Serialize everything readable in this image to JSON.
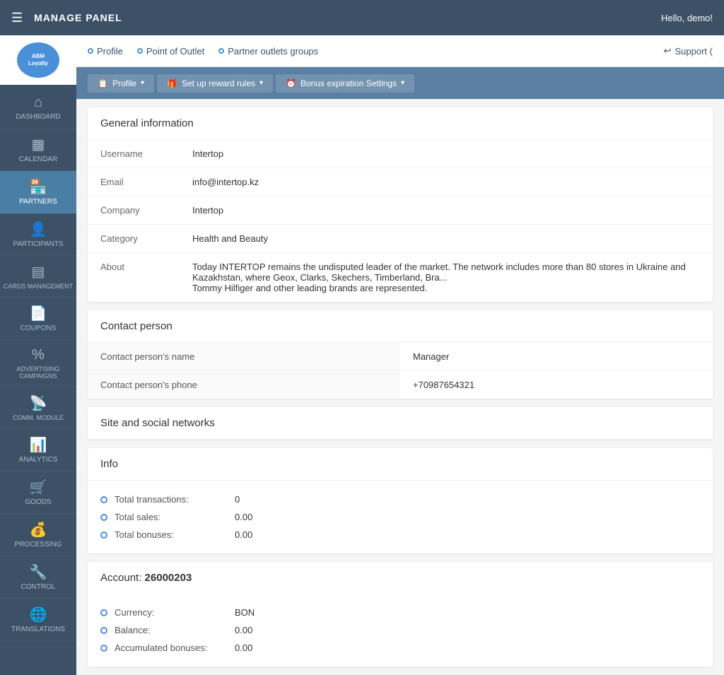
{
  "topbar": {
    "hamburger": "☰",
    "title": "MANAGE PANEL",
    "hello": "Hello, demo!"
  },
  "sidebar": {
    "logo_text": "ABM Loyalty",
    "items": [
      {
        "id": "dashboard",
        "label": "DASHBOARD",
        "icon": "⌂"
      },
      {
        "id": "calendar",
        "label": "CALENDAR",
        "icon": "📅"
      },
      {
        "id": "partners",
        "label": "PARTNERS",
        "icon": "🏪",
        "active": true
      },
      {
        "id": "participants",
        "label": "PARTICIPANTS",
        "icon": "👤"
      },
      {
        "id": "cards",
        "label": "CARDS MANAGEMENT",
        "icon": "💳"
      },
      {
        "id": "coupons",
        "label": "COUPONS",
        "icon": "📄"
      },
      {
        "id": "advertising",
        "label": "ADVERTISING CAMPAIGNS",
        "icon": "%"
      },
      {
        "id": "comm_module",
        "label": "COMM. MODULE",
        "icon": "📡"
      },
      {
        "id": "analytics",
        "label": "ANALYTICS",
        "icon": "📊"
      },
      {
        "id": "goods",
        "label": "GOODS",
        "icon": "🛒"
      },
      {
        "id": "processing",
        "label": "PROCESSING",
        "icon": "💰"
      },
      {
        "id": "control",
        "label": "CONTROL",
        "icon": "🔧"
      },
      {
        "id": "translations",
        "label": "TRANSLATIONS",
        "icon": "🌐"
      }
    ]
  },
  "breadcrumb": {
    "items": [
      {
        "label": "Profile",
        "active": false
      },
      {
        "label": "Point of Outlet",
        "active": false
      },
      {
        "label": "Partner outlets groups",
        "active": false
      }
    ],
    "support": "Support ("
  },
  "subnav": {
    "buttons": [
      {
        "id": "profile",
        "label": "Profile",
        "icon": "📋"
      },
      {
        "id": "setup_reward",
        "label": "Set up reward rules",
        "icon": "🎁"
      },
      {
        "id": "bonus_expiration",
        "label": "Bonus expiration Settings",
        "icon": "⏰"
      }
    ]
  },
  "general_info": {
    "title": "General information",
    "rows": [
      {
        "label": "Username",
        "value": "Intertop"
      },
      {
        "label": "Email",
        "value": "info@intertop.kz"
      },
      {
        "label": "Company",
        "value": "Intertop"
      },
      {
        "label": "Category",
        "value": "Health and Beauty"
      },
      {
        "label": "About",
        "value": "Today INTERTOP remains the undisputed leader of the market. The network includes more than 80 stores in Ukraine and Kazakhstan, where Geox, Clarks, Skechers, Timberland, Bra... Tommy Hilfiger and other leading brands are represented."
      }
    ]
  },
  "contact_person": {
    "title": "Contact person",
    "rows": [
      {
        "label": "Contact person's name",
        "value": "Manager"
      },
      {
        "label": "Contact person's phone",
        "value": "+70987654321"
      }
    ]
  },
  "site_social": {
    "title": "Site and social networks"
  },
  "info_section": {
    "title": "Info",
    "items": [
      {
        "label": "Total transactions:",
        "value": "0"
      },
      {
        "label": "Total sales:",
        "value": "0.00"
      },
      {
        "label": "Total bonuses:",
        "value": "0.00"
      }
    ]
  },
  "account_section": {
    "label": "Account:",
    "number": "26000203",
    "items": [
      {
        "label": "Currency:",
        "value": "BON"
      },
      {
        "label": "Balance:",
        "value": "0.00"
      },
      {
        "label": "Accumulated bonuses:",
        "value": "0.00"
      }
    ]
  }
}
